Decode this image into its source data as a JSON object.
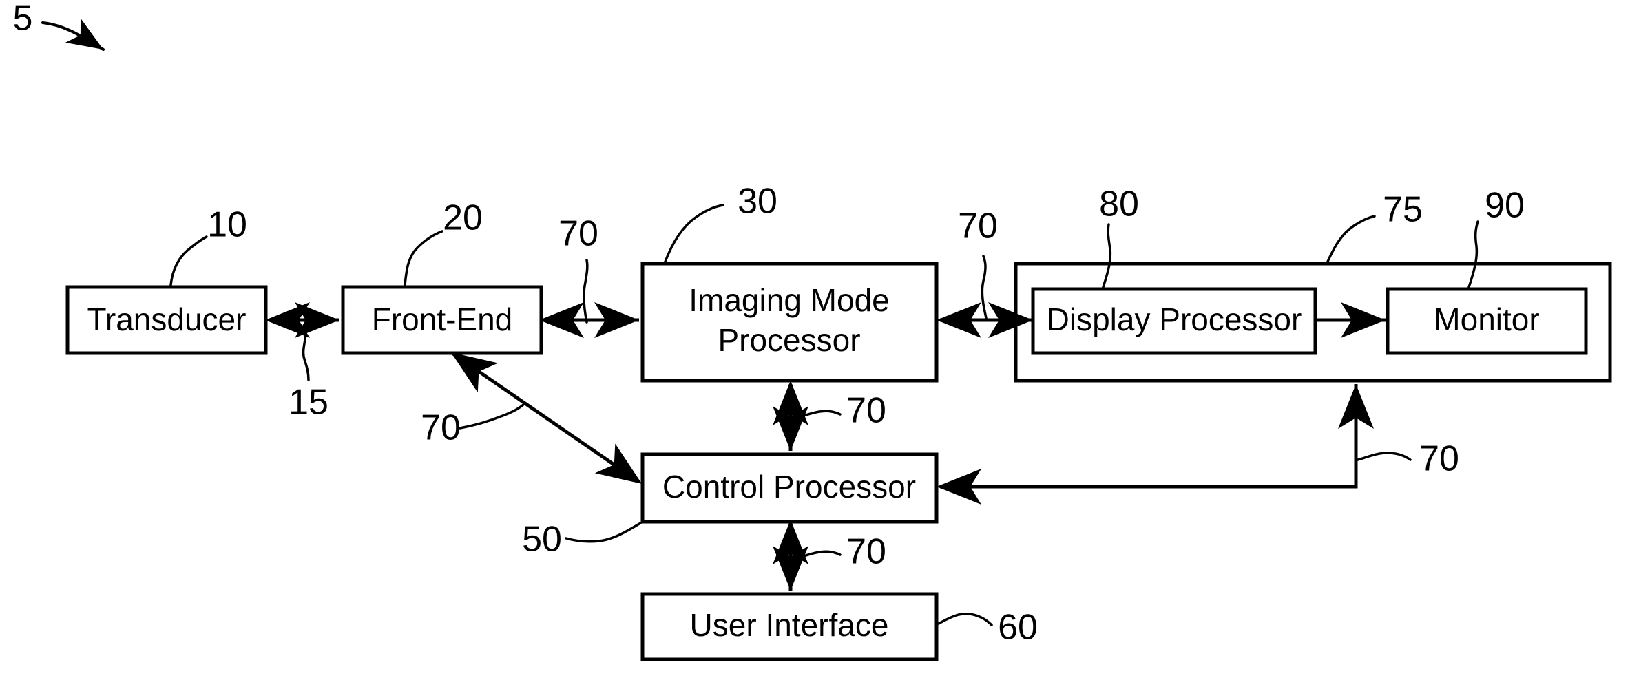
{
  "figure": {
    "figure_ref": "5",
    "background_color": "#ffffff",
    "line_color": "#000000"
  },
  "blocks": [
    {
      "id": "transducer",
      "label": "Transducer",
      "ref": "10"
    },
    {
      "id": "front_end",
      "label": "Front-End",
      "ref": "20"
    },
    {
      "id": "imaging_mode",
      "label_line1": "Imaging Mode",
      "label_line2": "Processor",
      "ref": "30"
    },
    {
      "id": "display_processor",
      "label": "Display Processor",
      "ref": "80"
    },
    {
      "id": "monitor",
      "label": "Monitor",
      "ref": "90"
    },
    {
      "id": "control_processor",
      "label": "Control Processor",
      "ref": "50"
    },
    {
      "id": "user_interface",
      "label": "User Interface",
      "ref": "60"
    },
    {
      "id": "display_group",
      "label": "",
      "ref": "75"
    }
  ],
  "connection_refs": {
    "transducer_front_end": "15",
    "front_end_imaging": "70",
    "imaging_display": "70",
    "imaging_control": "70",
    "control_front_end": "70",
    "control_user_interface": "70",
    "display_group_control": "70"
  },
  "labels": {
    "transducer": "Transducer",
    "front_end": "Front-End",
    "imaging_mode_l1": "Imaging Mode",
    "imaging_mode_l2": "Processor",
    "display_processor": "Display Processor",
    "monitor": "Monitor",
    "control_processor": "Control Processor",
    "user_interface": "User Interface"
  },
  "refs": {
    "figure": "5",
    "transducer": "10",
    "transducer_link": "15",
    "front_end": "20",
    "imaging_mode": "30",
    "control_processor": "50",
    "user_interface": "60",
    "display_group": "75",
    "display_processor": "80",
    "monitor": "90",
    "bus_a": "70",
    "bus_b": "70",
    "bus_c": "70",
    "bus_d": "70",
    "bus_e": "70",
    "bus_f": "70"
  }
}
